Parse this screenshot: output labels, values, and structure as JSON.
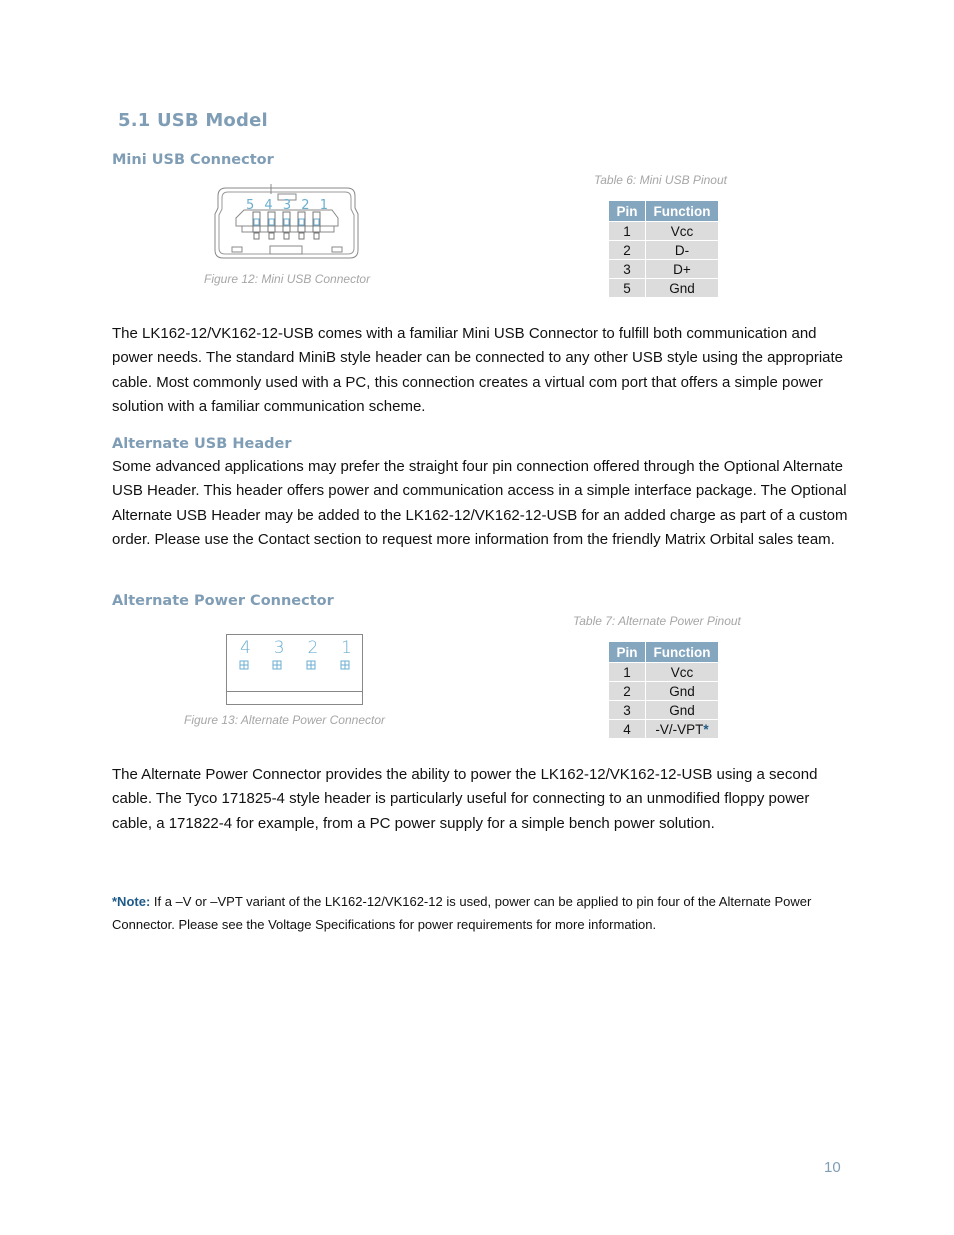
{
  "section_title": "5.1 USB Model",
  "mini_usb": {
    "heading": "Mini USB Connector",
    "figure_caption": "Figure 12: Mini USB Connector",
    "figure_pin_labels": [
      "5",
      "4",
      "3",
      "2",
      "1"
    ],
    "table_caption": "Table 6: Mini USB Pinout",
    "table": {
      "headers": [
        "Pin",
        "Function"
      ],
      "rows": [
        [
          "1",
          "Vcc"
        ],
        [
          "2",
          "D-"
        ],
        [
          "3",
          "D+"
        ],
        [
          "5",
          "Gnd"
        ]
      ]
    },
    "paragraph": "The LK162-12/VK162-12-USB comes with a familiar Mini USB Connector to fulfill both communication and power needs.  The standard MiniB style header can be connected to any other USB style using the appropriate cable.  Most commonly used with a PC, this connection creates a virtual com port that offers a simple power solution with a familiar communication scheme."
  },
  "alt_usb": {
    "heading": "Alternate USB Header",
    "paragraph": "Some advanced applications may prefer the straight four pin connection offered through the Optional Alternate USB Header.  This header offers power and communication access in a simple interface package.  The Optional Alternate USB Header may be added to the LK162-12/VK162-12-USB for an added charge as part of a custom order.  Please use the Contact section to request more information from the friendly Matrix Orbital sales team."
  },
  "alt_power": {
    "heading": "Alternate Power Connector",
    "figure_caption": "Figure 13: Alternate Power Connector",
    "figure_pin_labels": [
      "4",
      "3",
      "2",
      "1"
    ],
    "table_caption": "Table 7: Alternate Power Pinout",
    "table": {
      "headers": [
        "Pin",
        "Function"
      ],
      "rows": [
        [
          "1",
          "Vcc"
        ],
        [
          "2",
          "Gnd"
        ],
        [
          "3",
          "Gnd"
        ],
        [
          "4",
          "-V/-VPT"
        ]
      ],
      "footnote_marker": "*"
    },
    "paragraph": "The Alternate Power Connector provides the ability to power the LK162-12/VK162-12-USB using a second cable.  The Tyco 171825-4 style header is particularly useful for connecting to an unmodified floppy power cable, a 171822-4 for example, from a PC power supply for a simple bench power solution."
  },
  "note": {
    "label": "*Note:",
    "text": " If a –V or –VPT variant of the LK162-12/VK162-12 is used, power can be applied to pin four of the Alternate Power Connector.  Please see the Voltage Specifications for power requirements for more information."
  },
  "page_number": "10",
  "colors": {
    "heading": "#7f9db5",
    "table_header": "#84a6bf",
    "table_cell": "#dcdcdc",
    "note_accent": "#1e5a88",
    "caption": "#a6a6a6"
  }
}
